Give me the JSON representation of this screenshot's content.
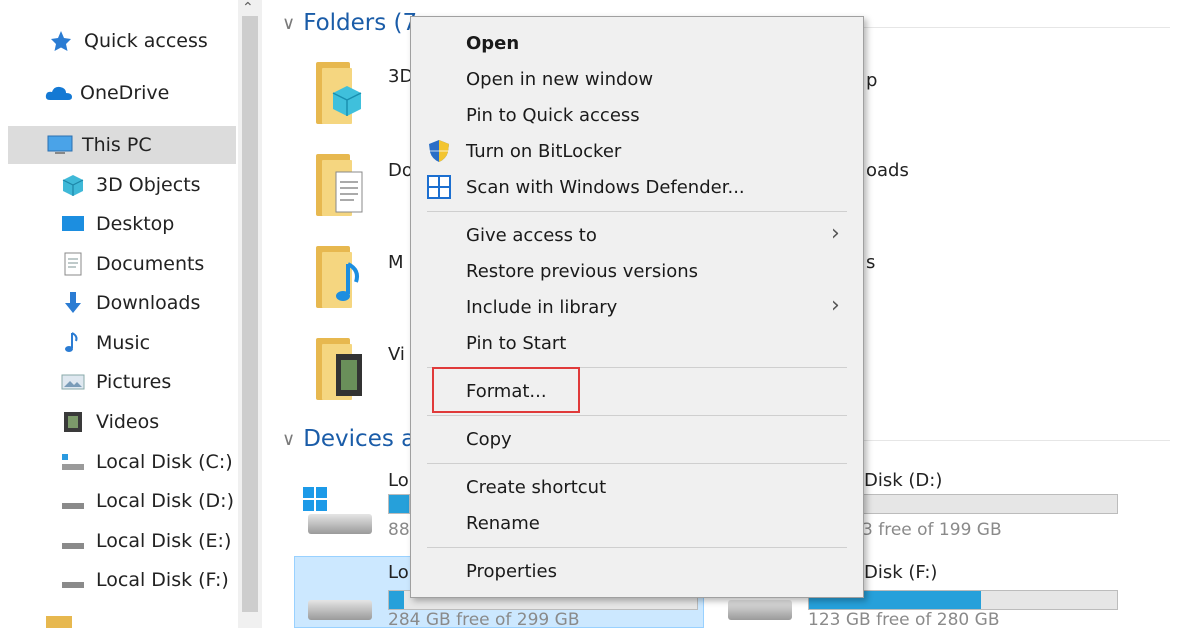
{
  "nav": {
    "items": [
      {
        "label": "Quick access"
      },
      {
        "label": "OneDrive"
      },
      {
        "label": "This PC"
      },
      {
        "label": "3D Objects"
      },
      {
        "label": "Desktop"
      },
      {
        "label": "Documents"
      },
      {
        "label": "Downloads"
      },
      {
        "label": "Music"
      },
      {
        "label": "Pictures"
      },
      {
        "label": "Videos"
      },
      {
        "label": "Local Disk (C:)"
      },
      {
        "label": "Local Disk (D:)"
      },
      {
        "label": "Local Disk  (E:)"
      },
      {
        "label": "Local Disk (F:)"
      }
    ]
  },
  "main": {
    "folders_header": "Folders (7",
    "devices_header": "Devices a",
    "folders": [
      {
        "label": "3D",
        "right_label": "p"
      },
      {
        "label": "Do",
        "right_label": "oads"
      },
      {
        "label": "M",
        "right_label": "s"
      },
      {
        "label": "Vi"
      }
    ],
    "drives": [
      {
        "label": "Lo",
        "free": "88",
        "right_label": "Disk (D:)",
        "right_free": "3 free of 199 GB",
        "right_fill": 0
      },
      {
        "label": "Lo",
        "free": "284 GB free of 299 GB",
        "fill": 0.05,
        "right_label": "Disk (F:)",
        "right_free": "123 GB free of 280 GB",
        "right_fill": 0.56
      }
    ]
  },
  "context_menu": {
    "items": {
      "open": "Open",
      "open_new_window": "Open in new window",
      "pin_quick_access": "Pin to Quick access",
      "bitlocker": "Turn on BitLocker",
      "defender": "Scan with Windows Defender...",
      "give_access": "Give access to",
      "restore": "Restore previous versions",
      "include_library": "Include in library",
      "pin_start": "Pin to Start",
      "format": "Format...",
      "copy": "Copy",
      "create_shortcut": "Create shortcut",
      "rename": "Rename",
      "properties": "Properties"
    },
    "highlight_color": "#e03a3a"
  },
  "colors": {
    "accent": "#26a0da",
    "selection": "#cce8ff",
    "folder": "#f5d680"
  }
}
